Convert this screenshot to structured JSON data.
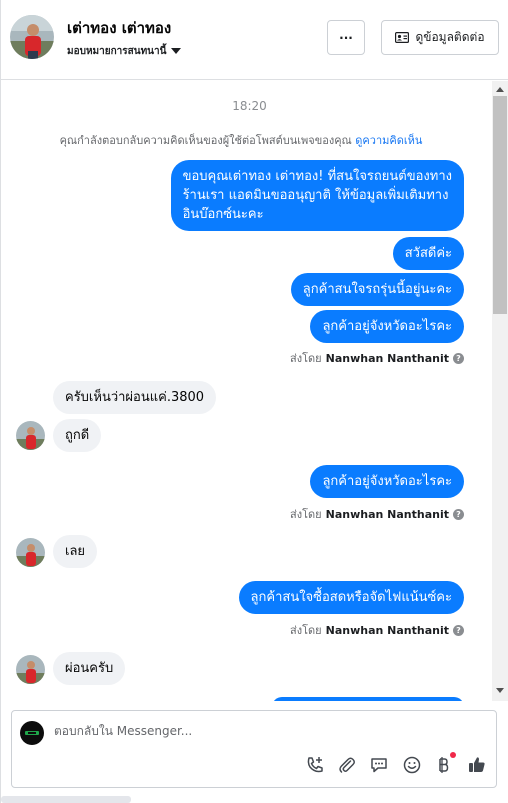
{
  "header": {
    "contact_name": "เต่าทอง เต่าทอง",
    "assign_label": "มอบหมายการสนทนานี้",
    "more_label": "···",
    "contact_info_label": "ดูข้อมูลติดต่อ"
  },
  "conversation": {
    "timestamp": "18:20",
    "notice_text": "คุณกำลังตอบกลับความคิดเห็นของผู้ใช้ต่อโพสต์บนเพจของคุณ",
    "notice_link": "ดูความคิดเห็น",
    "sent_by_prefix": "ส่งโดย",
    "sender_name": "Nanwhan Nanthanit",
    "messages": [
      {
        "dir": "out",
        "text_lines": [
          "ขอบคุณเต่าทอง เต่าทอง! ที่สนใจรถยนต์ของทาง",
          "ร้านเรา แอดมินขออนุญาติ ให้ข้อมูลเพิ่มเติมทาง",
          "อินบ๊อกซ์นะคะ"
        ]
      },
      {
        "dir": "out",
        "text": "สวัสดีค่ะ"
      },
      {
        "dir": "out",
        "text": "ลูกค้าสนใจรถรุ่นนี้อยู่นะคะ"
      },
      {
        "dir": "out",
        "text": "ลูกค้าอยู่จังหวัดอะไรคะ"
      },
      {
        "dir": "in",
        "text": "ครับเห็นว่าผ่อนแค่.3800"
      },
      {
        "dir": "in",
        "text": "ถูกดี"
      },
      {
        "dir": "out",
        "text": "ลูกค้าอยู่จังหวัดอะไรคะ"
      },
      {
        "dir": "in",
        "text": "เลย"
      },
      {
        "dir": "out",
        "text": "ลูกค้าสนใจซื้อสดหรือจัดไฟแน้นซ์คะ"
      },
      {
        "dir": "in",
        "text": "ผ่อนครับ"
      }
    ]
  },
  "composer": {
    "placeholder": "ตอบกลับใน Messenger...",
    "tools": [
      "call-icon",
      "attachment-icon",
      "saved-replies-icon",
      "emoji-icon",
      "payment-icon",
      "like-icon"
    ]
  },
  "colors": {
    "accent": "#0a7cff",
    "incoming_bg": "#f0f2f5",
    "link": "#1877f2",
    "notification_dot": "#f02849"
  }
}
